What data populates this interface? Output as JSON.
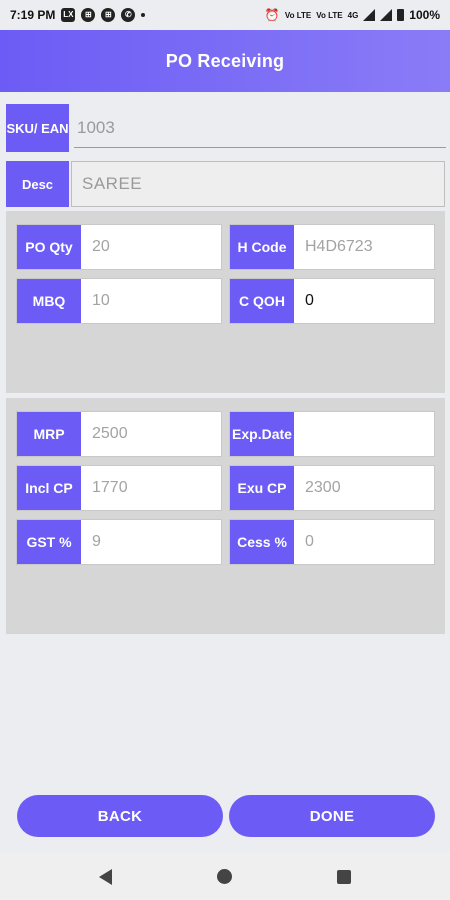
{
  "status": {
    "time": "7:19 PM",
    "battery": "100%",
    "left_icons": [
      "lx-icon",
      "grid-icon",
      "grid-icon",
      "whatsapp-icon"
    ],
    "right_icons": [
      "alarm-icon",
      "volte-icon",
      "volte-icon",
      "4g-icon",
      "signal-icon",
      "signal-icon",
      "battery-icon"
    ],
    "volte1": "Vo LTE",
    "volte2": "Vo LTE",
    "net": "4G"
  },
  "app": {
    "title": "PO Receiving"
  },
  "sku": {
    "label": "SKU/ EAN",
    "value": "1003"
  },
  "desc": {
    "label": "Desc",
    "value": "SAREE"
  },
  "panel1": {
    "po_qty": {
      "label": "PO Qty",
      "value": "20"
    },
    "h_code": {
      "label": "H Code",
      "value": "H4D6723"
    },
    "mbq": {
      "label": "MBQ",
      "value": "10"
    },
    "c_qoh": {
      "label": "C QOH",
      "value": "0"
    }
  },
  "panel2": {
    "mrp": {
      "label": "MRP",
      "value": "2500"
    },
    "exp_date": {
      "label": "Exp.Date",
      "value": ""
    },
    "incl_cp": {
      "label": "Incl CP",
      "value": "1770"
    },
    "exu_cp": {
      "label": "Exu CP",
      "value": "2300"
    },
    "gst": {
      "label": "GST %",
      "value": "9"
    },
    "cess": {
      "label": "Cess %",
      "value": "0"
    }
  },
  "buttons": {
    "back": "BACK",
    "done": "DONE"
  },
  "colors": {
    "accent": "#6C5CF5",
    "panel": "#D6D6D6",
    "background": "#ECEDF0"
  }
}
